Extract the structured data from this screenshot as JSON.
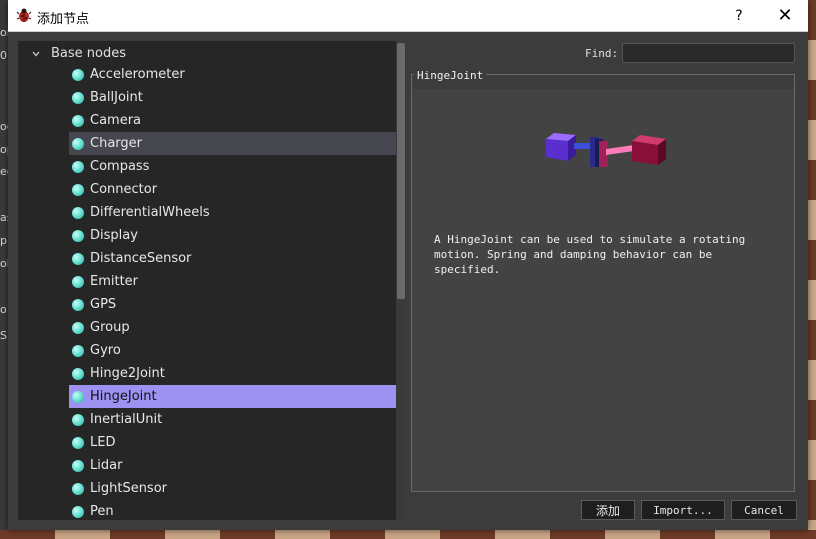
{
  "window": {
    "title": "添加节点",
    "help_label": "?",
    "close_label": "✕"
  },
  "background": {
    "left_fragments": [
      "or",
      "0",
      "oc",
      "op",
      "ec",
      "as",
      "p",
      "ob",
      "o",
      "S"
    ]
  },
  "tree": {
    "root_label": "Base nodes",
    "items": [
      {
        "label": "Accelerometer"
      },
      {
        "label": "BallJoint"
      },
      {
        "label": "Camera"
      },
      {
        "label": "Charger"
      },
      {
        "label": "Compass"
      },
      {
        "label": "Connector"
      },
      {
        "label": "DifferentialWheels"
      },
      {
        "label": "Display"
      },
      {
        "label": "DistanceSensor"
      },
      {
        "label": "Emitter"
      },
      {
        "label": "GPS"
      },
      {
        "label": "Group"
      },
      {
        "label": "Gyro"
      },
      {
        "label": "Hinge2Joint"
      },
      {
        "label": "HingeJoint"
      },
      {
        "label": "InertialUnit"
      },
      {
        "label": "LED"
      },
      {
        "label": "Lidar"
      },
      {
        "label": "LightSensor"
      },
      {
        "label": "Pen"
      }
    ],
    "hover_index": 3,
    "selected_index": 14
  },
  "find": {
    "label": "Find:",
    "value": ""
  },
  "info": {
    "group_title": "HingeJoint",
    "description": "A HingeJoint can be used to simulate a rotating motion. Spring and damping behavior can be specified."
  },
  "buttons": {
    "add": "添加",
    "import": "Import...",
    "cancel": "Cancel"
  },
  "colors": {
    "selection": "#9d92f2",
    "hover": "#46464e",
    "dot": "#6de3d6"
  }
}
